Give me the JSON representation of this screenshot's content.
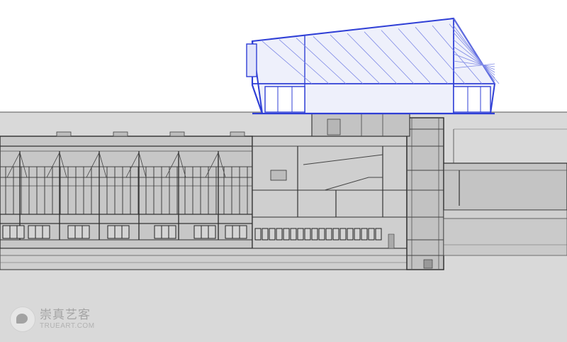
{
  "drawing": {
    "kind": "architectural-section",
    "colors": {
      "background": "#ffffff",
      "ground_fill": "#d6d6d6",
      "building_fill": "#c9c9c9",
      "line": "#3a3a3a",
      "light_line": "#777777",
      "roof_structure": "#2f3fd6",
      "roof_glazing": "#7d88e6"
    }
  },
  "watermark": {
    "name_cn": "崇真艺客",
    "name_en": "TRUEART.COM",
    "icon": "chat-bubble-logo-icon"
  }
}
